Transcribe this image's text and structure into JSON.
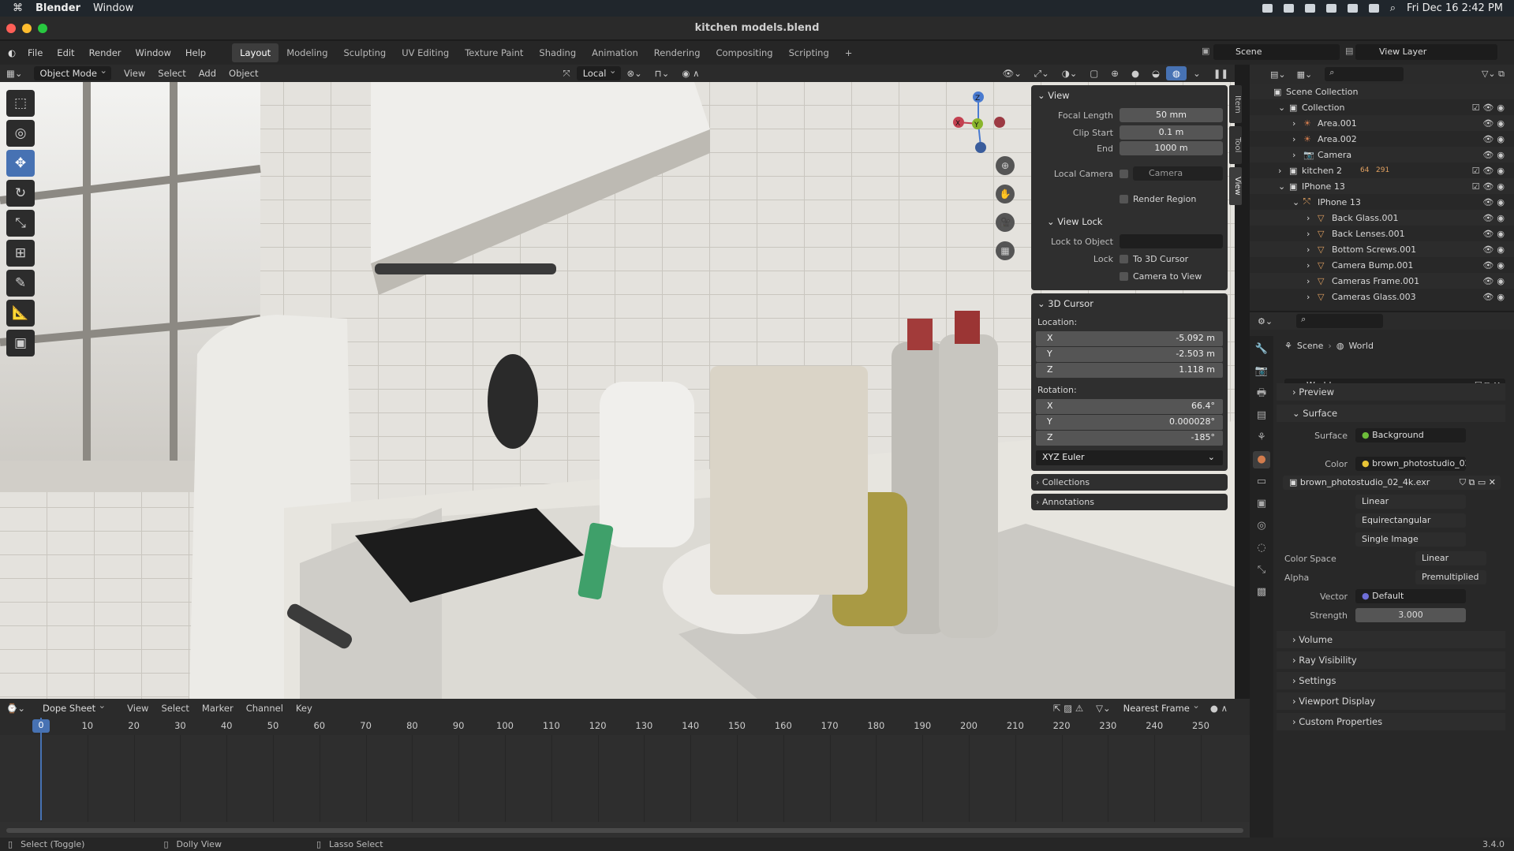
{
  "mac": {
    "apple": "",
    "app": "Blender",
    "menu": [
      "Window"
    ],
    "datetime": "Fri Dec 16  2:42 PM"
  },
  "window": {
    "title": "kitchen models.blend"
  },
  "topmenu": {
    "items": [
      "File",
      "Edit",
      "Render",
      "Window",
      "Help"
    ],
    "workspaces": [
      "Layout",
      "Modeling",
      "Sculpting",
      "UV Editing",
      "Texture Paint",
      "Shading",
      "Animation",
      "Rendering",
      "Compositing",
      "Scripting"
    ],
    "active_workspace": "Layout",
    "add": "+",
    "scene": "Scene",
    "view_layer": "View Layer"
  },
  "viewport_header": {
    "mode": "Object Mode",
    "menus": [
      "View",
      "Select",
      "Add",
      "Object"
    ],
    "orientation": "Local"
  },
  "npanel": {
    "tabs": [
      "Item",
      "Tool",
      "View"
    ],
    "active_tab": "View",
    "view": {
      "title": "View",
      "focal_length_label": "Focal Length",
      "focal_length": "50 mm",
      "clip_start_label": "Clip Start",
      "clip_start": "0.1 m",
      "end_label": "End",
      "end": "1000 m",
      "local_camera_label": "Local Camera",
      "local_camera": "Camera",
      "render_region": "Render Region"
    },
    "view_lock": {
      "title": "View Lock",
      "lock_to_object_label": "Lock to Object",
      "lock_label": "Lock",
      "to_3d_cursor": "To 3D Cursor",
      "camera_to_view": "Camera to View"
    },
    "cursor": {
      "title": "3D Cursor",
      "location_label": "Location:",
      "location": [
        {
          "k": "X",
          "v": "-5.092 m"
        },
        {
          "k": "Y",
          "v": "-2.503 m"
        },
        {
          "k": "Z",
          "v": "1.118 m"
        }
      ],
      "rotation_label": "Rotation:",
      "rotation": [
        {
          "k": "X",
          "v": "66.4°"
        },
        {
          "k": "Y",
          "v": "0.000028°"
        },
        {
          "k": "Z",
          "v": "-185°"
        }
      ],
      "rotation_mode": "XYZ Euler"
    },
    "collections": "Collections",
    "annotations": "Annotations"
  },
  "outliner": {
    "rows": [
      {
        "name": "Scene Collection",
        "icon": "scene-collection-icon"
      },
      {
        "name": "Collection",
        "icon": "collection-icon"
      },
      {
        "name": "Area.001",
        "icon": "light-icon"
      },
      {
        "name": "Area.002",
        "icon": "light-icon"
      },
      {
        "name": "Camera",
        "icon": "camera-icon"
      },
      {
        "name": "kitchen 2",
        "icon": "collection-icon",
        "badge1": "64",
        "badge2": "291"
      },
      {
        "name": "IPhone 13",
        "icon": "collection-icon"
      },
      {
        "name": "IPhone 13",
        "icon": "empty-icon"
      },
      {
        "name": "Back Glass.001",
        "icon": "mesh-icon"
      },
      {
        "name": "Back Lenses.001",
        "icon": "mesh-icon"
      },
      {
        "name": "Bottom Screws.001",
        "icon": "mesh-icon"
      },
      {
        "name": "Camera Bump.001",
        "icon": "mesh-icon"
      },
      {
        "name": "Cameras Frame.001",
        "icon": "mesh-icon"
      },
      {
        "name": "Cameras Glass.003",
        "icon": "mesh-icon"
      }
    ]
  },
  "properties": {
    "breadcrumb": [
      "Scene",
      "World"
    ],
    "world_name": "World",
    "sections": {
      "preview": "Preview",
      "surface": "Surface",
      "volume": "Volume",
      "ray_visibility": "Ray Visibility",
      "settings": "Settings",
      "viewport_display": "Viewport Display",
      "custom_properties": "Custom Properties"
    },
    "surface_label": "Surface",
    "surface_value": "Background",
    "color_label": "Color",
    "color_value": "brown_photostudio_02...",
    "image_name": "brown_photostudio_02_4k.exr",
    "interpolation": "Linear",
    "projection": "Equirectangular",
    "source": "Single Image",
    "color_space_label": "Color Space",
    "color_space": "Linear",
    "alpha_label": "Alpha",
    "alpha": "Premultiplied",
    "vector_label": "Vector",
    "vector": "Default",
    "strength_label": "Strength",
    "strength": "3.000"
  },
  "dopesheet": {
    "editor": "Dope Sheet",
    "menus": [
      "View",
      "Select",
      "Marker",
      "Channel",
      "Key"
    ],
    "snap": "Nearest Frame",
    "ticks": [
      "0",
      "10",
      "20",
      "30",
      "40",
      "50",
      "60",
      "70",
      "80",
      "90",
      "100",
      "110",
      "120",
      "130",
      "140",
      "150",
      "160",
      "170",
      "180",
      "190",
      "200",
      "210",
      "220",
      "230",
      "240",
      "250"
    ],
    "current_frame": "0"
  },
  "statusbar": {
    "items": [
      "Select (Toggle)",
      "Dolly View",
      "Lasso Select"
    ],
    "version": "3.4.0"
  },
  "colors": {
    "accent": "#4772b3",
    "world_orange": "#d27c4d"
  }
}
